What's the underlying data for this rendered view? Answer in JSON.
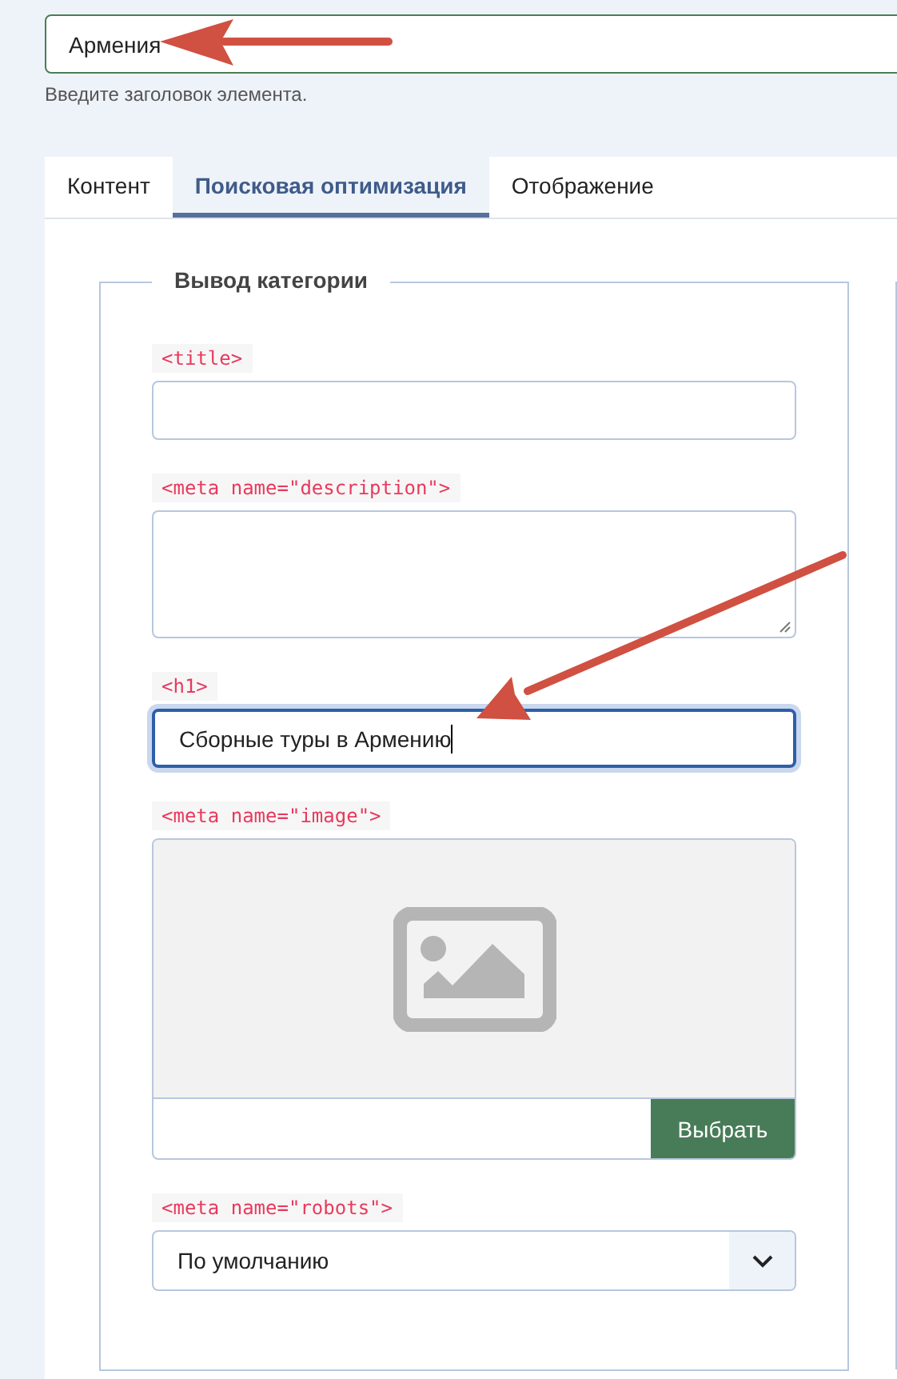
{
  "title_field": {
    "value": "Армения",
    "hint": "Введите заголовок элемента."
  },
  "tabs": [
    {
      "label": "Контент",
      "selected": false
    },
    {
      "label": "Поисковая оптимизация",
      "selected": true
    },
    {
      "label": "Отображение",
      "selected": false
    }
  ],
  "fieldset": {
    "legend": "Вывод категории",
    "fields": [
      {
        "kind": "input",
        "label": "<title>",
        "focused": false
      },
      {
        "kind": "textarea",
        "label": "<meta name=\"description\">"
      },
      {
        "kind": "input",
        "label": "<h1>",
        "value": "Сборные туры в Армению",
        "focused": true
      },
      {
        "kind": "image",
        "label": "<meta name=\"image\">",
        "button": "Выбрать"
      },
      {
        "kind": "select",
        "label": "<meta name=\"robots\">",
        "value": "По умолчанию"
      }
    ]
  }
}
